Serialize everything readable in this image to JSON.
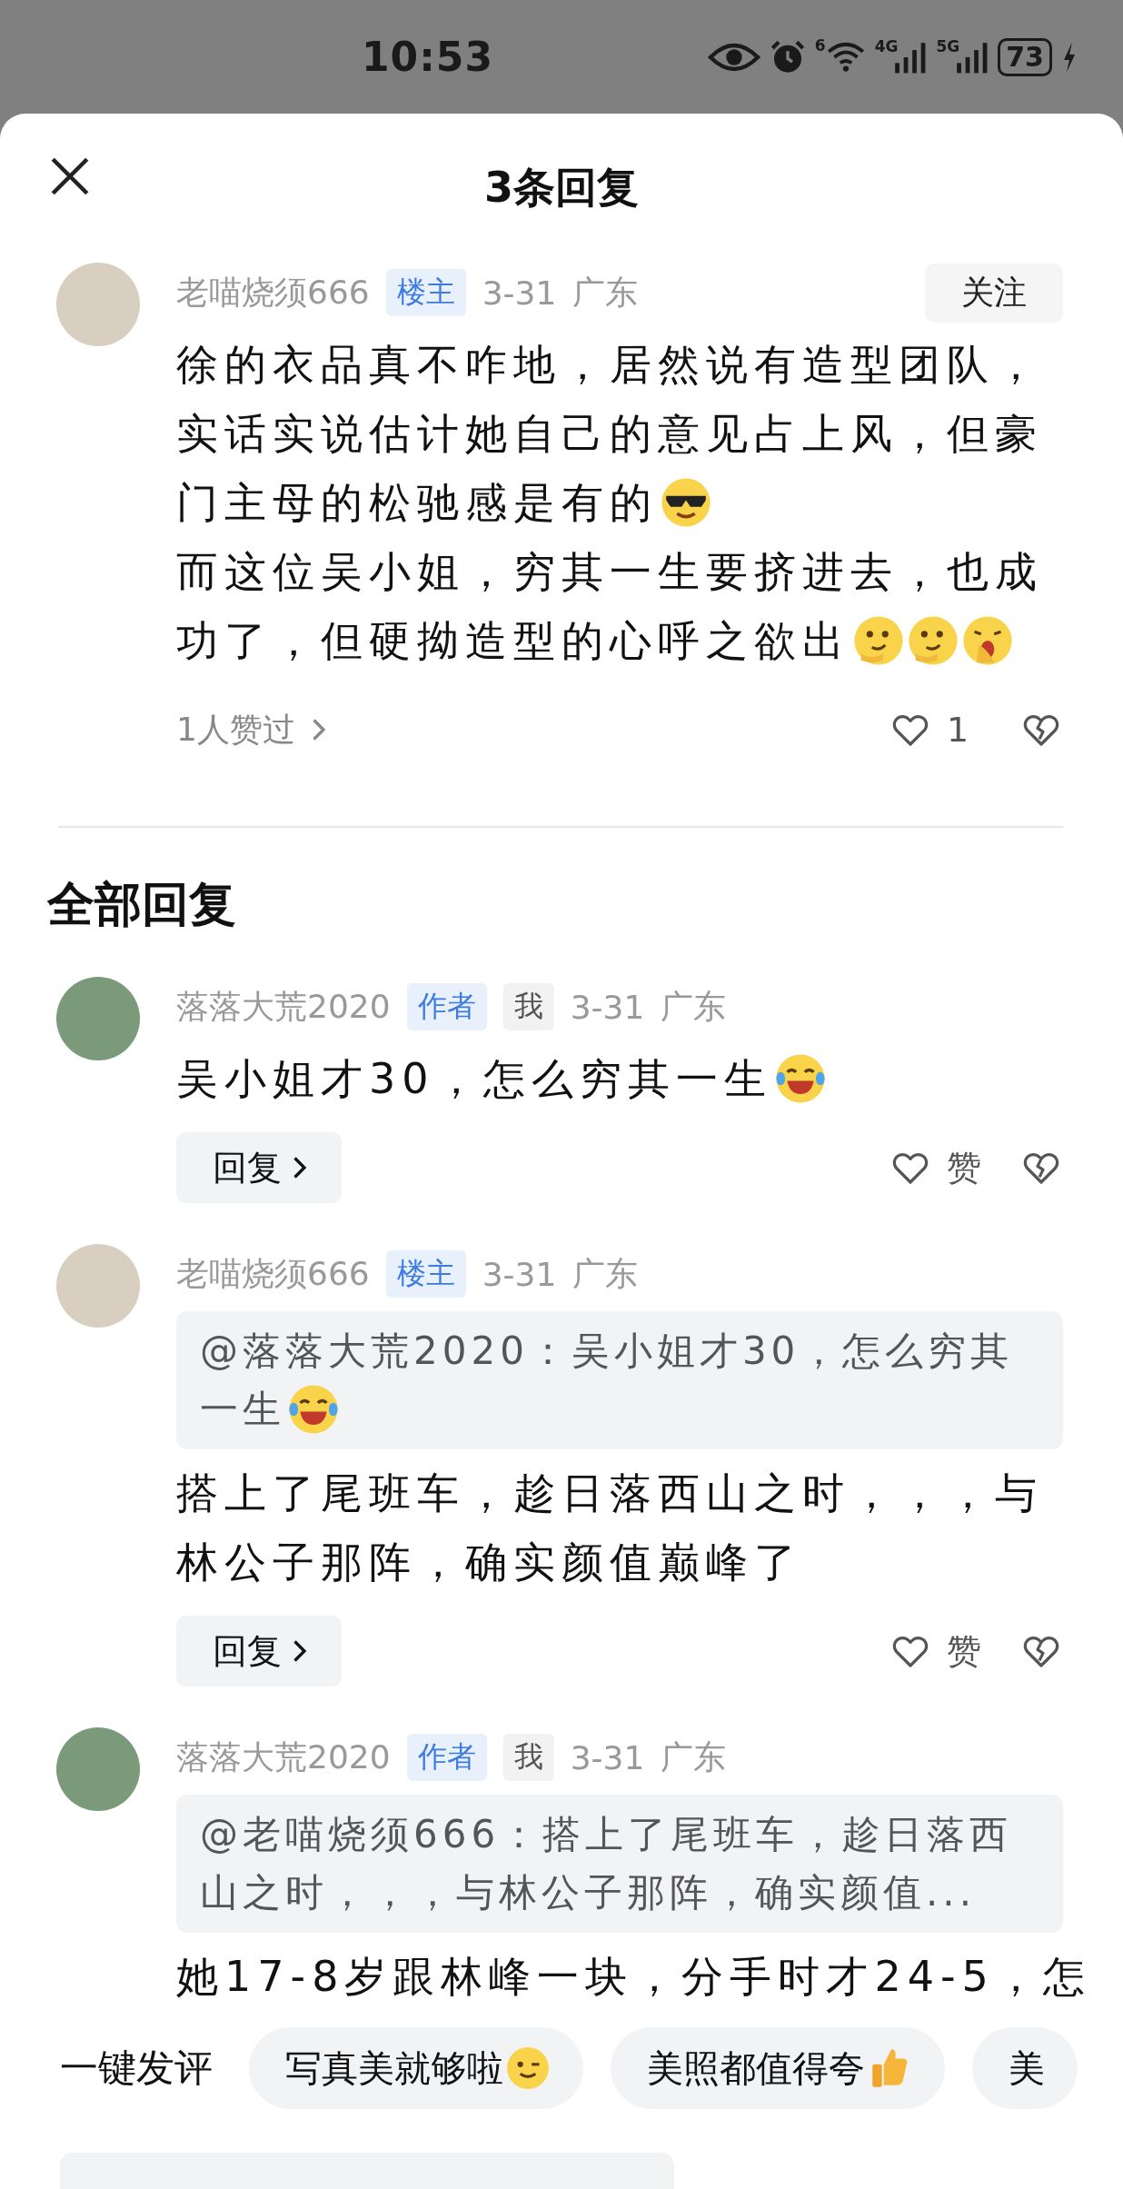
{
  "status_bar": {
    "time": "10:53",
    "wifi_label": "6",
    "cell_labels": [
      "4G",
      "5G"
    ],
    "battery": "73"
  },
  "header": {
    "title": "3条回复"
  },
  "main_comment": {
    "avatar": {
      "kind": "cat"
    },
    "author": "老喵烧须666",
    "badges": [
      {
        "label": "楼主",
        "kind": "owner"
      }
    ],
    "date": "3-31",
    "location": "广东",
    "follow_button": "关注",
    "lines": [
      {
        "text": "徐的衣品真不咋地，居然说有造型团队，"
      },
      {
        "text": "实话实说估计她自己的意见占上风，但豪"
      },
      {
        "text": "门主母的松驰感是有的",
        "emojis": [
          {
            "kind": "sunglasses"
          }
        ]
      },
      {
        "text": "而这位吴小姐，穷其一生要挤进去，也成"
      },
      {
        "text": "功了，但硬拗造型的心呼之欲出",
        "emojis": [
          {
            "kind": "smirk"
          },
          {
            "kind": "smirk"
          },
          {
            "kind": "yawn"
          }
        ]
      }
    ],
    "likers": "1人赞过",
    "like_count": "1"
  },
  "section_title": "全部回复",
  "replies": [
    {
      "avatar": {
        "kind": "girl"
      },
      "author": "落落大荒2020",
      "badges": [
        {
          "label": "作者",
          "kind": "owner"
        },
        {
          "label": "我",
          "kind": "self"
        }
      ],
      "date": "3-31",
      "location": "广东",
      "lines": [
        {
          "text": "吴小姐才30，怎么穷其一生",
          "emojis": [
            {
              "kind": "laugh"
            }
          ]
        }
      ],
      "reply_button": "回复",
      "like_label": "赞"
    },
    {
      "avatar": {
        "kind": "cat"
      },
      "author": "老喵烧须666",
      "badges": [
        {
          "label": "楼主",
          "kind": "owner"
        }
      ],
      "date": "3-31",
      "location": "广东",
      "quote": [
        {
          "text": "@落落大荒2020：吴小姐才30，怎么穷其"
        },
        {
          "text": "一生",
          "emojis": [
            {
              "kind": "laugh"
            }
          ]
        }
      ],
      "lines": [
        {
          "text": "搭上了尾班车，趁日落西山之时，，，与"
        },
        {
          "text": "林公子那阵，确实颜值巅峰了"
        }
      ],
      "reply_button": "回复",
      "like_label": "赞"
    },
    {
      "avatar": {
        "kind": "girl"
      },
      "author": "落落大荒2020",
      "badges": [
        {
          "label": "作者",
          "kind": "owner"
        },
        {
          "label": "我",
          "kind": "self"
        }
      ],
      "date": "3-31",
      "location": "广东",
      "quote": [
        {
          "text": "@老喵烧须666：搭上了尾班车，趁日落西"
        },
        {
          "text": "山之时，，，与林公子那阵，确实颜值..."
        }
      ],
      "lines": [
        {
          "text": "她17-8岁跟林峰一块，分手时才24-5，怎"
        }
      ]
    }
  ],
  "quick_comments": {
    "label": "一键发评",
    "chips": [
      {
        "text": "写真美就够啦",
        "emoji": {
          "kind": "wink"
        }
      },
      {
        "text": "美照都值得夸",
        "emoji": {
          "kind": "thumbsup"
        }
      },
      {
        "text": "美"
      }
    ]
  }
}
